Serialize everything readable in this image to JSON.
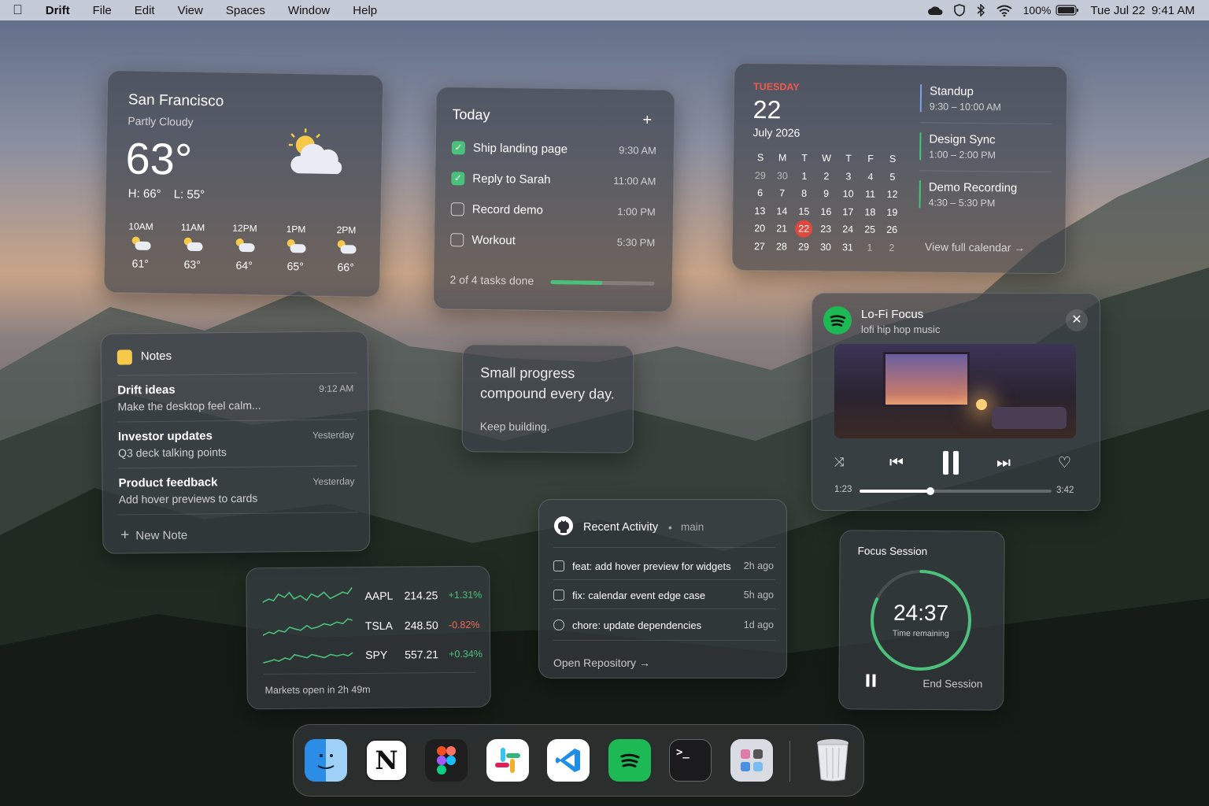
{
  "menubar": {
    "app": "Drift",
    "menus": [
      "File",
      "Edit",
      "View",
      "Spaces",
      "Window",
      "Help"
    ],
    "battery": "100%",
    "date": "Tue Jul 22",
    "time": "9:41 AM",
    "icons": [
      "apple-icon",
      "cloud-icon",
      "shield-icon",
      "bluetooth-icon",
      "wifi-icon",
      "battery-icon"
    ]
  },
  "weather": {
    "city": "San Francisco",
    "condition": "Partly Cloudy",
    "temp": "63°",
    "high": "H: 66°",
    "low": "L: 55°",
    "hourly": [
      {
        "time": "10AM",
        "temp": "61°"
      },
      {
        "time": "11AM",
        "temp": "63°"
      },
      {
        "time": "12PM",
        "temp": "64°"
      },
      {
        "time": "1PM",
        "temp": "65°"
      },
      {
        "time": "2PM",
        "temp": "66°"
      }
    ]
  },
  "today": {
    "title": "Today",
    "tasks": [
      {
        "label": "Ship landing page",
        "time": "9:30 AM",
        "done": true
      },
      {
        "label": "Reply to Sarah",
        "time": "11:00 AM",
        "done": true
      },
      {
        "label": "Record demo",
        "time": "1:00 PM",
        "done": false
      },
      {
        "label": "Workout",
        "time": "5:30 PM",
        "done": false
      }
    ],
    "summary": "2 of 4 tasks done",
    "progress": 0.5,
    "accent": "#4bc07a"
  },
  "calendar": {
    "weekday": "TUESDAY",
    "day": "22",
    "month": "July 2026",
    "headers": [
      "S",
      "M",
      "T",
      "W",
      "T",
      "F",
      "S"
    ],
    "weeks": [
      [
        "29",
        "30",
        "1",
        "2",
        "3",
        "4",
        "5"
      ],
      [
        "6",
        "7",
        "8",
        "9",
        "10",
        "11",
        "12"
      ],
      [
        "13",
        "14",
        "15",
        "16",
        "17",
        "18",
        "19"
      ],
      [
        "20",
        "21",
        "22",
        "23",
        "24",
        "25",
        "26"
      ],
      [
        "27",
        "28",
        "29",
        "30",
        "31",
        "1",
        "2"
      ]
    ],
    "events": [
      {
        "name": "Standup",
        "time": "9:30 – 10:00 AM"
      },
      {
        "name": "Design Sync",
        "time": "1:00 – 2:00 PM"
      },
      {
        "name": "Demo Recording",
        "time": "4:30 – 5:30 PM"
      }
    ],
    "link": "View full calendar",
    "today_color": "#e0483e"
  },
  "notes": {
    "title": "Notes",
    "items": [
      {
        "title": "Drift ideas",
        "body": "Make the desktop feel calm...",
        "time": "9:12 AM"
      },
      {
        "title": "Investor updates",
        "body": "Q3 deck talking points",
        "time": "Yesterday"
      },
      {
        "title": "Product feedback",
        "body": "Add hover previews to cards",
        "time": "Yesterday"
      }
    ],
    "new_note": "New Note"
  },
  "quote": {
    "line1": "Small progress",
    "line2": "compound every day.",
    "sub": "Keep building."
  },
  "music": {
    "playlist": "Lo-Fi Focus",
    "subtitle": "lofi hip hop music",
    "elapsed": "1:23",
    "total": "3:42",
    "progress": 0.37,
    "accent": "#1db954"
  },
  "stocks": {
    "rows": [
      {
        "symbol": "AAPL",
        "price": "214.25",
        "change": "+1.31%",
        "color": "#4bc07a"
      },
      {
        "symbol": "TSLA",
        "price": "248.50",
        "change": "-0.82%",
        "color": "#ef6b5b"
      },
      {
        "symbol": "SPY",
        "price": "557.21",
        "change": "+0.34%",
        "color": "#4bc07a"
      }
    ],
    "footer": "Markets open in 2h 49m"
  },
  "github": {
    "title": "Recent Activity",
    "branch": "main",
    "commits": [
      {
        "msg": "feat: add hover preview for widgets",
        "time": "2h ago"
      },
      {
        "msg": "fix: calendar event edge case",
        "time": "5h ago"
      },
      {
        "msg": "chore: update dependencies",
        "time": "1d ago"
      }
    ],
    "link": "Open Repository"
  },
  "focus": {
    "title": "Focus Session",
    "time": "24:37",
    "label": "Time remaining",
    "end": "End Session",
    "progress": 0.82,
    "accent": "#4bc07a"
  },
  "dock": {
    "apps": [
      "finder-icon",
      "notion-icon",
      "figma-icon",
      "slack-icon",
      "vscode-icon",
      "spotify-icon",
      "terminal-icon",
      "launchpad-icon",
      "trash-icon"
    ]
  }
}
